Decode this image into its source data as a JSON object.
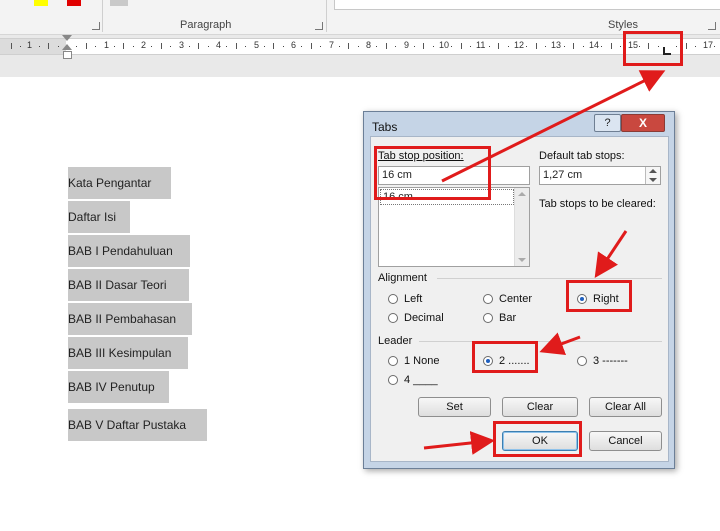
{
  "ribbon": {
    "paragraph_label": "Paragraph",
    "styles_label": "Styles"
  },
  "ruler": {
    "numbers": [
      "1",
      "1",
      "2",
      "3",
      "4",
      "5",
      "6",
      "7",
      "8",
      "9",
      "10",
      "11",
      "12",
      "13",
      "14",
      "15",
      "17"
    ]
  },
  "document": {
    "lines": [
      "Kata Pengantar",
      "Daftar Isi",
      "BAB I Pendahuluan",
      "BAB II Dasar Teori",
      "BAB II Pembahasan",
      "BAB III Kesimpulan",
      "BAB IV Penutup",
      "BAB V Daftar Pustaka"
    ]
  },
  "dialog": {
    "title": "Tabs",
    "help_label": "?",
    "close_label": "X",
    "tab_stop_position_label": "Tab stop position:",
    "tab_stop_position_value": "16 cm",
    "tab_stop_list": [
      "16 cm"
    ],
    "default_tab_stops_label": "Default tab stops:",
    "default_tab_stops_value": "1,27 cm",
    "to_be_cleared_label": "Tab stops to be cleared:",
    "alignment_label": "Alignment",
    "alignment": [
      "Left",
      "Center",
      "Right",
      "Decimal",
      "Bar"
    ],
    "alignment_selected": "Right",
    "leader_label": "Leader",
    "leader": [
      "1 None",
      "2 .......",
      "3 -------",
      "4 ____"
    ],
    "leader_selected": "2 .......",
    "set_label": "Set",
    "clear_label": "Clear",
    "clear_all_label": "Clear All",
    "ok_label": "OK",
    "cancel_label": "Cancel"
  },
  "colors": {
    "annotation_red": "#e01b1b",
    "highlight_gray": "#c8c8c8",
    "dialog_frame": "#c5d4e6"
  }
}
